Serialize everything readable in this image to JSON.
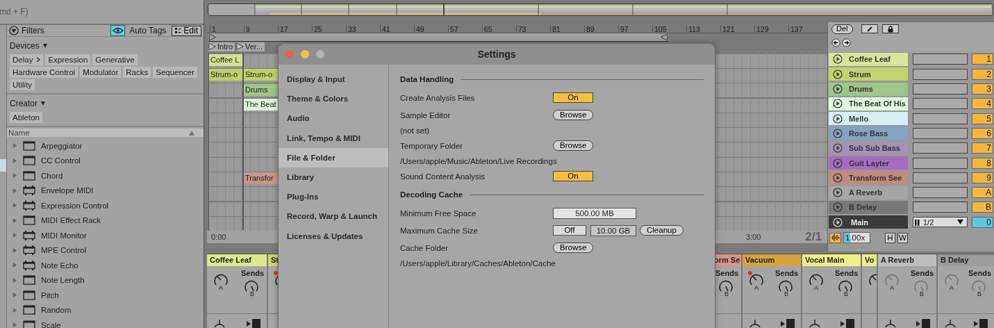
{
  "browser": {
    "search_hint": "md + F)",
    "filters": "Filters",
    "auto_tags": {
      "label": "Auto Tags",
      "on": true
    },
    "edit": "Edit",
    "devices": {
      "label": "Devices",
      "tags": [
        {
          "label": "Delay",
          "more": true
        },
        {
          "label": "Expression",
          "more": false
        },
        {
          "label": "Generative",
          "more": false
        },
        {
          "label": "Hardware Control",
          "more": false
        },
        {
          "label": "Modulator",
          "more": false
        },
        {
          "label": "Racks",
          "more": false
        },
        {
          "label": "Sequencer",
          "more": false
        },
        {
          "label": "Utility",
          "more": false
        }
      ]
    },
    "creator": {
      "label": "Creator",
      "tags": [
        {
          "label": "Ableton",
          "more": false
        }
      ]
    },
    "column": "Name",
    "items": [
      {
        "name": "Arpeggiator",
        "kind": "frame"
      },
      {
        "name": "CC Control",
        "kind": "frame"
      },
      {
        "name": "Chord",
        "kind": "frame"
      },
      {
        "name": "Envelope MIDI",
        "kind": "module"
      },
      {
        "name": "Expression Control",
        "kind": "module"
      },
      {
        "name": "MIDI Effect Rack",
        "kind": "frame"
      },
      {
        "name": "MIDI Monitor",
        "kind": "module"
      },
      {
        "name": "MPE Control",
        "kind": "module"
      },
      {
        "name": "Note Echo",
        "kind": "module"
      },
      {
        "name": "Note Length",
        "kind": "frame"
      },
      {
        "name": "Pitch",
        "kind": "frame"
      },
      {
        "name": "Random",
        "kind": "frame"
      },
      {
        "name": "Scale",
        "kind": "frame"
      }
    ]
  },
  "arrangement": {
    "ruler": [
      "1",
      "9",
      "17",
      "25",
      "33",
      "41",
      "49",
      "57",
      "65",
      "73",
      "81",
      "89",
      "97",
      "105",
      "113",
      "121",
      "129",
      "137"
    ],
    "locators": [
      "Intro",
      "Ver..."
    ],
    "rows": [
      {
        "first": {
          "name": "Coffee L",
          "color": "#d3e192"
        }
      },
      {
        "first": {
          "name": "Strum-o",
          "color": "#c2d06b"
        },
        "second": {
          "name": "Strum-o",
          "color": "#c2d06b"
        }
      },
      {
        "second": {
          "name": "Drums",
          "color": "#a0c38a"
        }
      },
      {
        "second": {
          "name": "The Beat",
          "color": "#e0f5dc"
        }
      },
      {},
      {},
      {},
      {},
      {
        "second": {
          "name": "Transfor",
          "color": "#c8958a"
        }
      },
      {},
      {},
      {}
    ],
    "time_start": "0:00",
    "time_end": "3:00",
    "zoom": "2/1"
  },
  "tracks": [
    {
      "name": "Coffee Leaf",
      "color": "#d8e59c",
      "slot": "1"
    },
    {
      "name": "Strum",
      "color": "#c3d36f",
      "slot": "2"
    },
    {
      "name": "Drums",
      "color": "#9fc58a",
      "slot": "3"
    },
    {
      "name": "The Beat Of His",
      "color": "#e3f7e0",
      "slot": "4"
    },
    {
      "name": "Mello",
      "color": "#d5f1f6",
      "slot": "5"
    },
    {
      "name": "Rose Bass",
      "color": "#84a3c2",
      "slot": "6"
    },
    {
      "name": "Sub Sub Bass",
      "color": "#a692b6",
      "slot": "7"
    },
    {
      "name": "Guit Layter",
      "color": "#a86bc2",
      "slot": "8"
    },
    {
      "name": "Transform See",
      "color": "#c08b80",
      "slot": "9"
    },
    {
      "name": "A Reverb",
      "color": "#a5a5a5",
      "slot": "A"
    },
    {
      "name": "B Delay",
      "color": "#797979",
      "slot": "B"
    }
  ],
  "main": {
    "name": "Main",
    "route": "1/2",
    "slot": "0"
  },
  "panel": {
    "delete": "Del",
    "speed": {
      "value": "1.00x",
      "level": 0.25
    },
    "buttons": [
      "H",
      "W"
    ]
  },
  "mixer_left": [
    {
      "name": "Coffee Leaf",
      "color": "#dde98e",
      "kind": "track",
      "armed": false,
      "sends": "Sends",
      "send_a": "A",
      "send_b": "B"
    },
    {
      "name": "St",
      "color": "#cfd86f",
      "kind": "cut_right",
      "armed": true
    }
  ],
  "mixer_right": [
    {
      "name": "orm Se",
      "color": "#d9958a",
      "kind": "cut_left",
      "armed": false,
      "sends": "Sends",
      "send_b": "B"
    },
    {
      "name": "Vacuum",
      "color": "#d6a43e",
      "kind": "track",
      "armed": true,
      "sends": "Sends",
      "send_a": "A",
      "send_b": "B"
    },
    {
      "name": "Vocal Main",
      "color": "#f0f08a",
      "kind": "track",
      "armed": false,
      "sends": "Sends",
      "send_a": "A",
      "send_b": "B"
    },
    {
      "name": "Vo",
      "color": "#f0f08a",
      "kind": "cut_right",
      "armed": false
    },
    {
      "name": "A Reverb",
      "color": "#bdbdbd",
      "kind": "return",
      "armed": false,
      "sends": "Sends",
      "send_a": "A",
      "send_b": "B"
    },
    {
      "name": "B Delay",
      "color": "#9c9c9c",
      "kind": "return",
      "armed": false,
      "sends": "Sends",
      "send_a": "A",
      "send_b": "B"
    }
  ],
  "settings": {
    "title": "Settings",
    "nav": [
      {
        "label": "Display & Input",
        "selected": false
      },
      {
        "label": "Theme & Colors",
        "selected": false
      },
      {
        "label": "Audio",
        "selected": false
      },
      {
        "label": "Link, Tempo & MIDI",
        "selected": false
      },
      {
        "label": "File & Folder",
        "selected": true
      },
      {
        "label": "Library",
        "selected": false
      },
      {
        "label": "Plug-Ins",
        "selected": false
      },
      {
        "label": "Record, Warp & Launch",
        "selected": false
      },
      {
        "label": "Licenses & Updates",
        "selected": false
      }
    ],
    "rows": [
      {
        "kind": "section",
        "label": "Data Handling"
      },
      {
        "kind": "toggle",
        "label": "Create Analysis Files",
        "value": "On",
        "on": true
      },
      {
        "kind": "browse",
        "label": "Sample Editor",
        "button": "Browse"
      },
      {
        "kind": "note",
        "label": "(not set)"
      },
      {
        "kind": "browse",
        "label": "Temporary Folder",
        "button": "Browse"
      },
      {
        "kind": "note",
        "label": "/Users/apple/Music/Ableton/Live Recordings"
      },
      {
        "kind": "toggle",
        "label": "Sound Content Analysis",
        "value": "On",
        "on": true
      },
      {
        "kind": "section",
        "label": "Decoding Cache"
      },
      {
        "kind": "field",
        "label": "Minimum Free Space",
        "value": "500.00 MB"
      },
      {
        "kind": "cache",
        "label": "Maximum Cache Size",
        "off": "Off",
        "value": "10.00 GB",
        "button": "Cleanup"
      },
      {
        "kind": "browse",
        "label": "Cache Folder",
        "button": "Browse"
      },
      {
        "kind": "note",
        "label": "/Users/apple/Library/Caches/Ableton/Cache"
      }
    ]
  }
}
